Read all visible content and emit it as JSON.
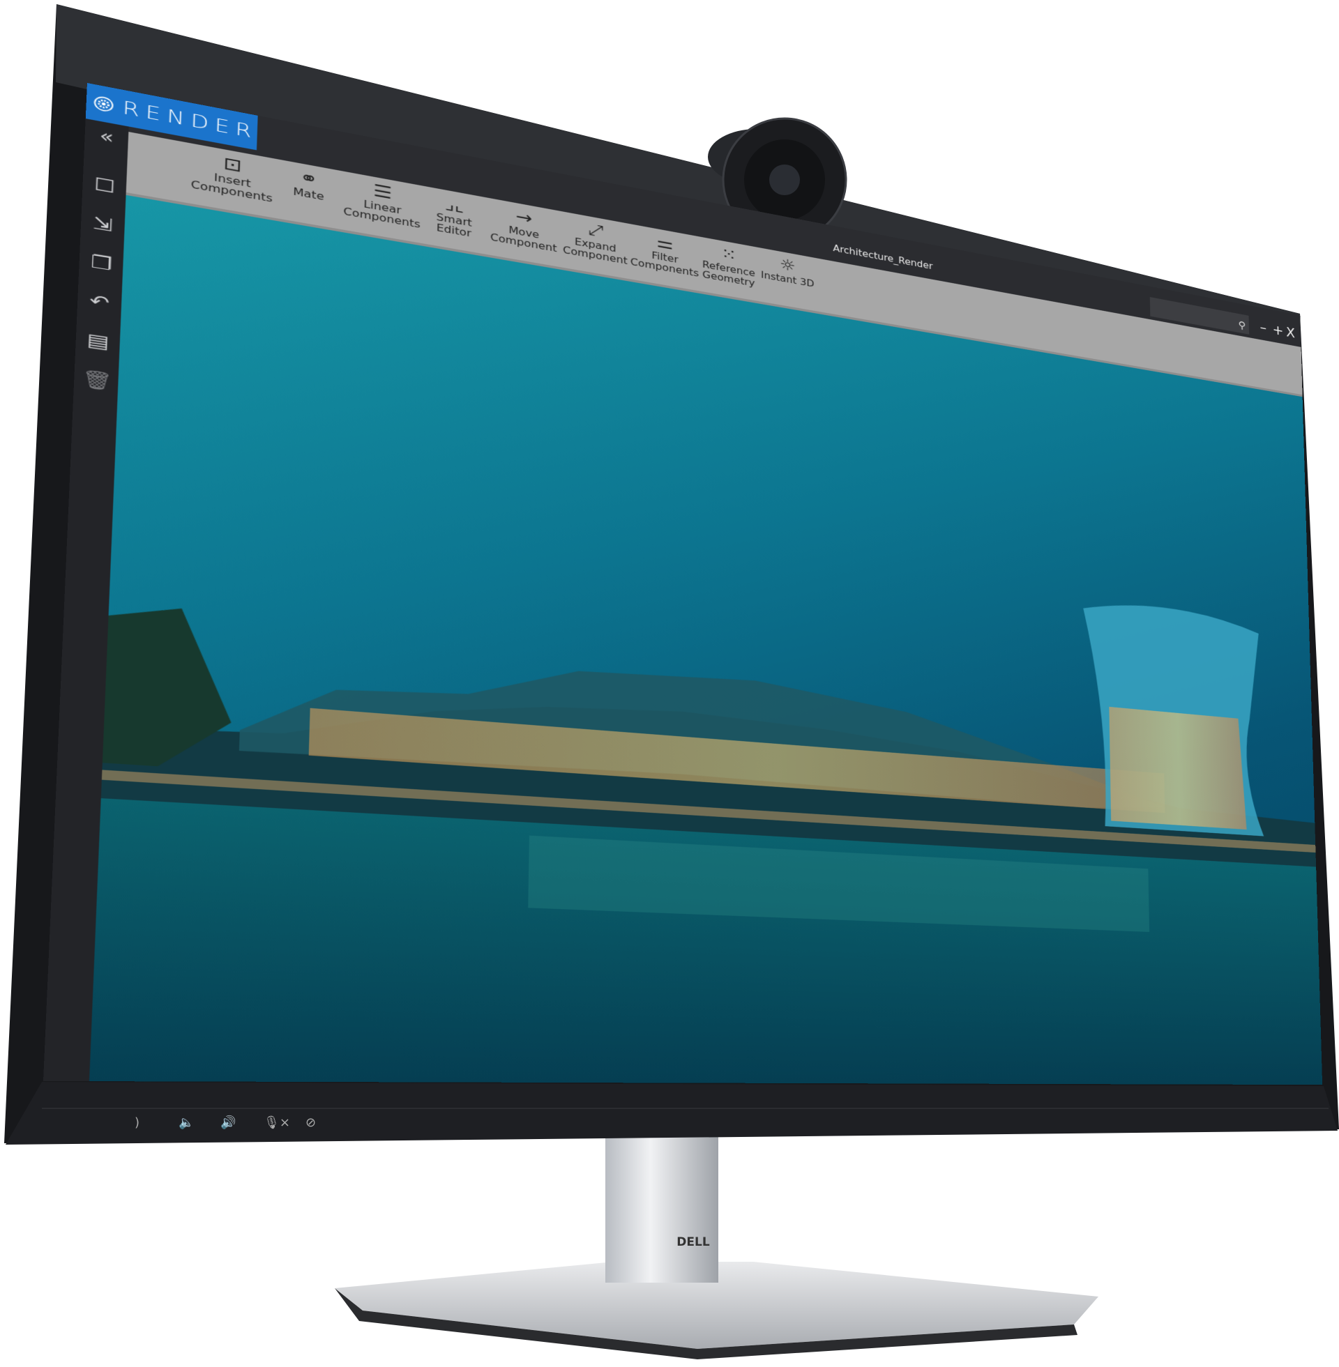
{
  "app": {
    "name": "RENDER",
    "brand_color": "#1b74cc",
    "document_title": "Architecture_Render",
    "search": {
      "placeholder": "",
      "icon": "search-icon"
    },
    "window_controls": {
      "minimize": "–",
      "maximize": "+",
      "close": "X"
    }
  },
  "sidebar": {
    "collapse": "«",
    "items": [
      {
        "icon": "square-select-icon"
      },
      {
        "icon": "import-icon"
      },
      {
        "icon": "layers-icon"
      },
      {
        "icon": "undo-icon"
      },
      {
        "icon": "document-icon"
      },
      {
        "icon": "trash-icon"
      }
    ]
  },
  "toolbar": {
    "items": [
      {
        "line1": "Insert",
        "line2": "Components",
        "icon": "insert-component-icon"
      },
      {
        "line1": "Mate",
        "line2": "",
        "icon": "link-icon"
      },
      {
        "line1": "Linear",
        "line2": "Components",
        "icon": "lines-icon"
      },
      {
        "line1": "Smart",
        "line2": "Editor",
        "icon": "corners-icon"
      },
      {
        "line1": "Move",
        "line2": "Component",
        "icon": "arrow-right-icon"
      },
      {
        "line1": "Expand",
        "line2": "Component",
        "icon": "expand-icon"
      },
      {
        "line1": "Filter",
        "line2": "Components",
        "icon": "sliders-icon"
      },
      {
        "line1": "Reference",
        "line2": "Geometry",
        "icon": "grid-icon"
      },
      {
        "line1": "Instant 3D",
        "line2": "",
        "icon": "sun-icon"
      }
    ]
  },
  "monitor": {
    "logo": "DELL",
    "chin_buttons": [
      {
        "icon": "phone-icon"
      },
      {
        "icon": "volume-down-icon"
      },
      {
        "icon": "volume-up-icon"
      },
      {
        "icon": "mic-mute-icon"
      },
      {
        "icon": "camera-off-icon"
      }
    ]
  }
}
